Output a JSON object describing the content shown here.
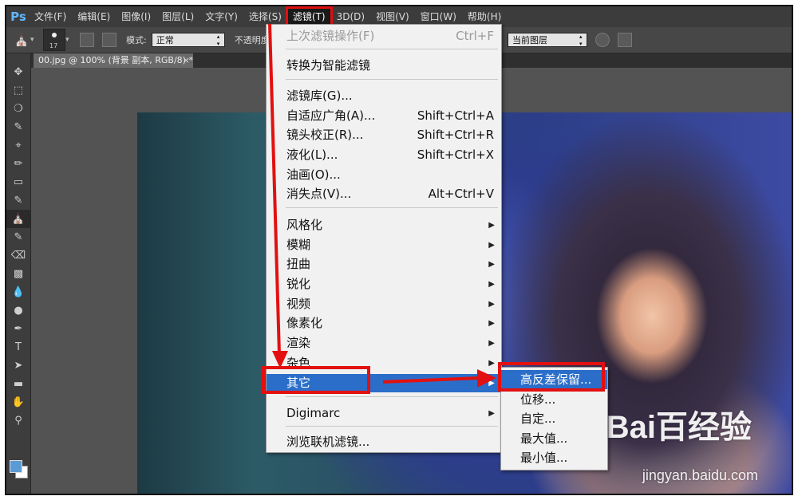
{
  "menubar": {
    "logo": "Ps",
    "items": [
      {
        "label": "文件(F)"
      },
      {
        "label": "编辑(E)"
      },
      {
        "label": "图像(I)"
      },
      {
        "label": "图层(L)"
      },
      {
        "label": "文字(Y)"
      },
      {
        "label": "选择(S)"
      },
      {
        "label": "滤镜(T)"
      },
      {
        "label": "3D(D)"
      },
      {
        "label": "视图(V)"
      },
      {
        "label": "窗口(W)"
      },
      {
        "label": "帮助(H)"
      }
    ]
  },
  "options": {
    "brush_size": "17",
    "mode_label": "模式:",
    "mode_value": "正常",
    "opacity_label": "不透明度",
    "sample_value": "当前图层"
  },
  "document": {
    "tab_title": "00.jpg @ 100% (背景 副本, RGB/8) *",
    "close": "×"
  },
  "filter_menu": {
    "last_filter": "上次滤镜操作(F)",
    "last_filter_shortcut": "Ctrl+F",
    "smart_filter": "转换为智能滤镜",
    "gallery": "滤镜库(G)...",
    "adaptive_wide": "自适应广角(A)...",
    "adaptive_wide_shortcut": "Shift+Ctrl+A",
    "lens_correction": "镜头校正(R)...",
    "lens_correction_shortcut": "Shift+Ctrl+R",
    "liquify": "液化(L)...",
    "liquify_shortcut": "Shift+Ctrl+X",
    "oil_paint": "油画(O)...",
    "vanishing_point": "消失点(V)...",
    "vanishing_point_shortcut": "Alt+Ctrl+V",
    "submenus": [
      "风格化",
      "模糊",
      "扭曲",
      "锐化",
      "视频",
      "像素化",
      "渲染",
      "杂色",
      "其它"
    ],
    "digimarc": "Digimarc",
    "browse_online": "浏览联机滤镜..."
  },
  "other_submenu": {
    "items": [
      "高反差保留...",
      "位移...",
      "自定...",
      "最大值...",
      "最小值..."
    ]
  },
  "watermark": {
    "logo": "Bai百经验",
    "url": "jingyan.baidu.com"
  },
  "colors": {
    "highlight": "#2b6ec9",
    "annotation_red": "#e31010"
  }
}
